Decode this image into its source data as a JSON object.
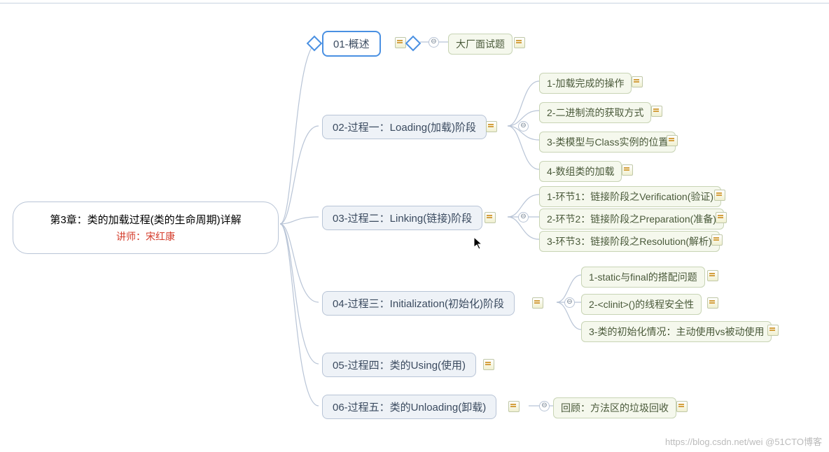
{
  "root": {
    "title": "第3章：类的加载过程(类的生命周期)详解",
    "subtitle": "讲师：宋红康"
  },
  "topics": [
    {
      "id": "t1",
      "label": "01-概述",
      "selected": true,
      "children": [
        {
          "label": "大厂面试题"
        }
      ]
    },
    {
      "id": "t2",
      "label": "02-过程一：Loading(加载)阶段",
      "children": [
        {
          "label": "1-加载完成的操作"
        },
        {
          "label": "2-二进制流的获取方式"
        },
        {
          "label": "3-类模型与Class实例的位置"
        },
        {
          "label": "4-数组类的加载"
        }
      ]
    },
    {
      "id": "t3",
      "label": "03-过程二：Linking(链接)阶段",
      "children": [
        {
          "label": "1-环节1：链接阶段之Verification(验证)"
        },
        {
          "label": "2-环节2：链接阶段之Preparation(准备)"
        },
        {
          "label": "3-环节3：链接阶段之Resolution(解析)"
        }
      ]
    },
    {
      "id": "t4",
      "label": "04-过程三：Initialization(初始化)阶段",
      "children": [
        {
          "label": "1-static与final的搭配问题"
        },
        {
          "label": "2-<clinit>()的线程安全性"
        },
        {
          "label": "3-类的初始化情况：主动使用vs被动使用"
        }
      ]
    },
    {
      "id": "t5",
      "label": "05-过程四：类的Using(使用)",
      "children": []
    },
    {
      "id": "t6",
      "label": "06-过程五：类的Unloading(卸载)",
      "children": [
        {
          "label": "回顾：方法区的垃圾回收"
        }
      ]
    }
  ],
  "watermark": "https://blog.csdn.net/wei @51CTO博客",
  "collapse_glyph": "⊖"
}
